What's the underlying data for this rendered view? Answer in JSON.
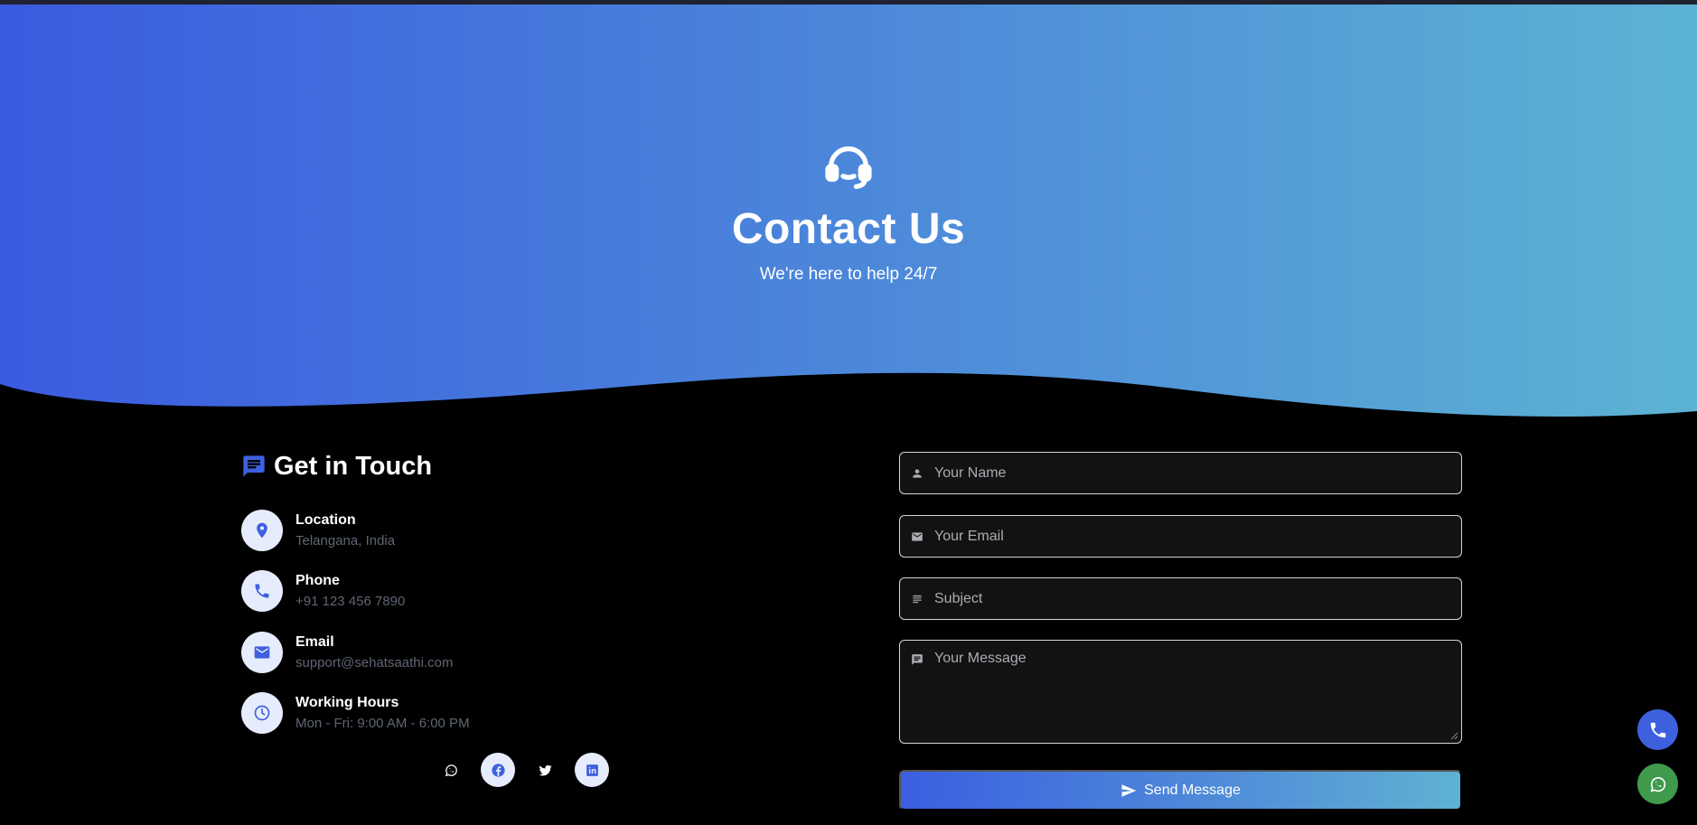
{
  "colors": {
    "gradient_start": "#3b5be0",
    "gradient_end": "#5cb3d3",
    "accent": "#3e60df",
    "whatsapp": "#3f9a4b",
    "background": "#000000"
  },
  "hero": {
    "icon": "headset-icon",
    "title": "Contact Us",
    "subtitle": "We're here to help 24/7"
  },
  "contact": {
    "heading": "Get in Touch",
    "heading_icon": "chat-icon",
    "items": [
      {
        "icon": "location-pin-icon",
        "label": "Location",
        "value": "Telangana, India"
      },
      {
        "icon": "phone-icon",
        "label": "Phone",
        "value": "+91 123 456 7890"
      },
      {
        "icon": "mail-icon",
        "label": "Email",
        "value": "support@sehatsaathi.com"
      },
      {
        "icon": "clock-icon",
        "label": "Working Hours",
        "value": "Mon - Fri: 9:00 AM - 6:00 PM"
      }
    ],
    "socials": [
      "whatsapp-icon",
      "facebook-icon",
      "twitter-icon",
      "linkedin-icon"
    ]
  },
  "form": {
    "name_placeholder": "Your Name",
    "email_placeholder": "Your Email",
    "subject_placeholder": "Subject",
    "message_placeholder": "Your Message",
    "submit_label": "Send Message"
  },
  "floating": {
    "call_icon": "phone-icon",
    "whatsapp_icon": "whatsapp-icon"
  }
}
